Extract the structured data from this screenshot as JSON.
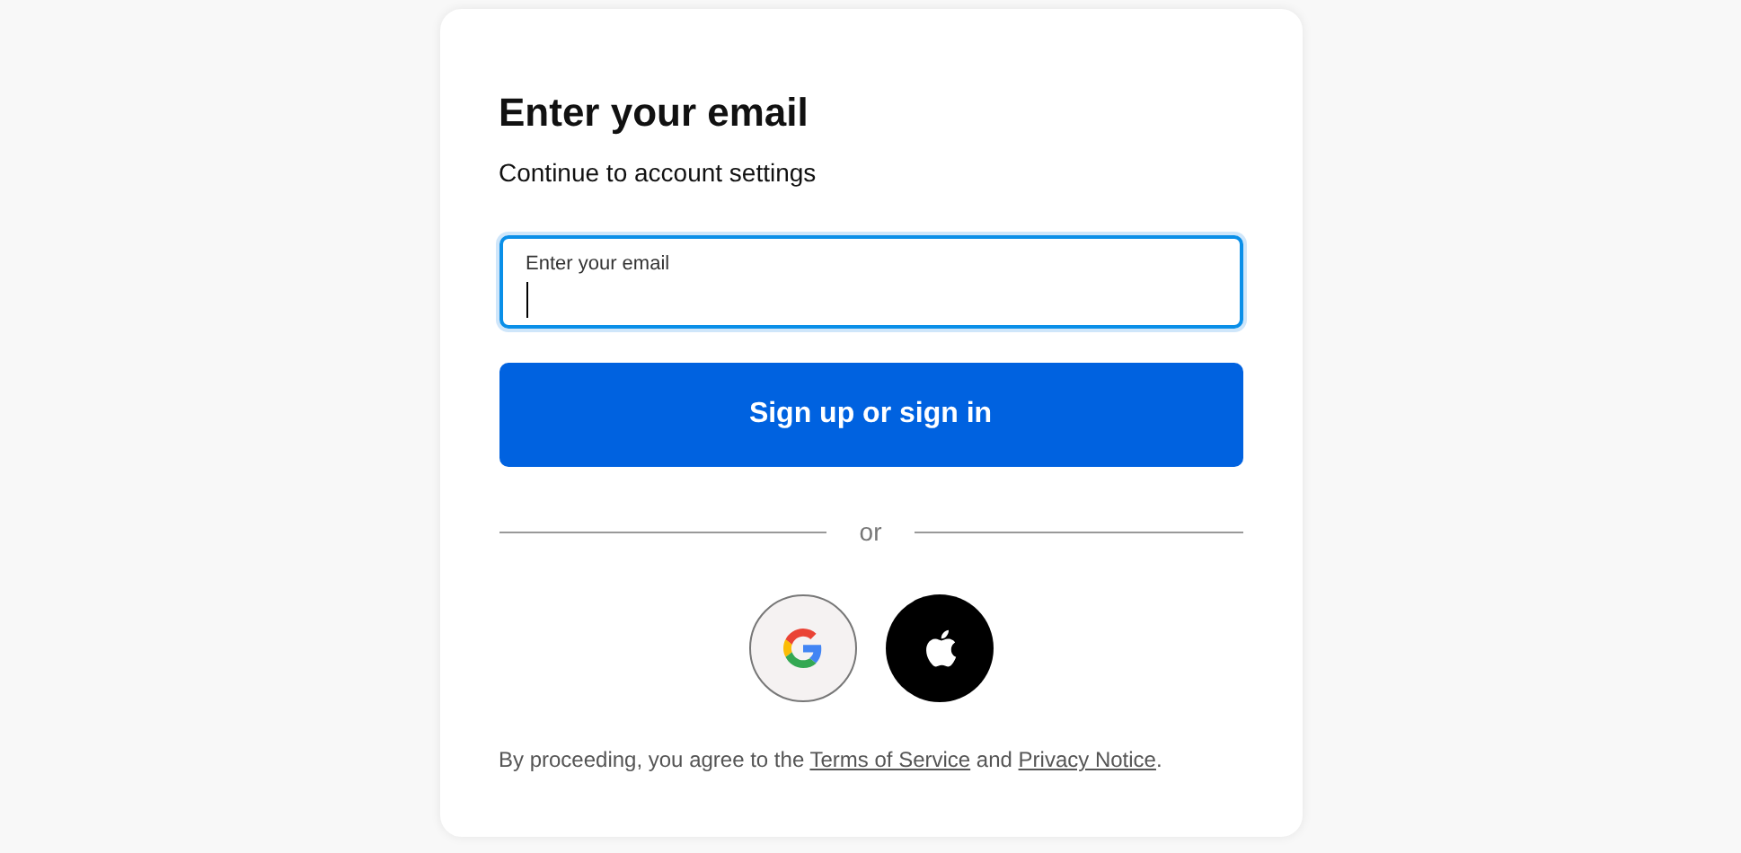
{
  "title": "Enter your email",
  "subtitle": "Continue to account settings",
  "email_field": {
    "label": "Enter your email",
    "focused": true
  },
  "submit_button": "Sign up or sign in",
  "divider": "or",
  "social_buttons": [
    {
      "kind": "google"
    },
    {
      "kind": "apple"
    }
  ],
  "legal": [
    {
      "kind": "text",
      "text": "By proceeding, you agree to the "
    },
    {
      "kind": "link",
      "text": "Terms of Service"
    },
    {
      "kind": "text",
      "text": " and "
    },
    {
      "kind": "link",
      "text": "Privacy Notice"
    },
    {
      "kind": "text",
      "text": "."
    }
  ]
}
